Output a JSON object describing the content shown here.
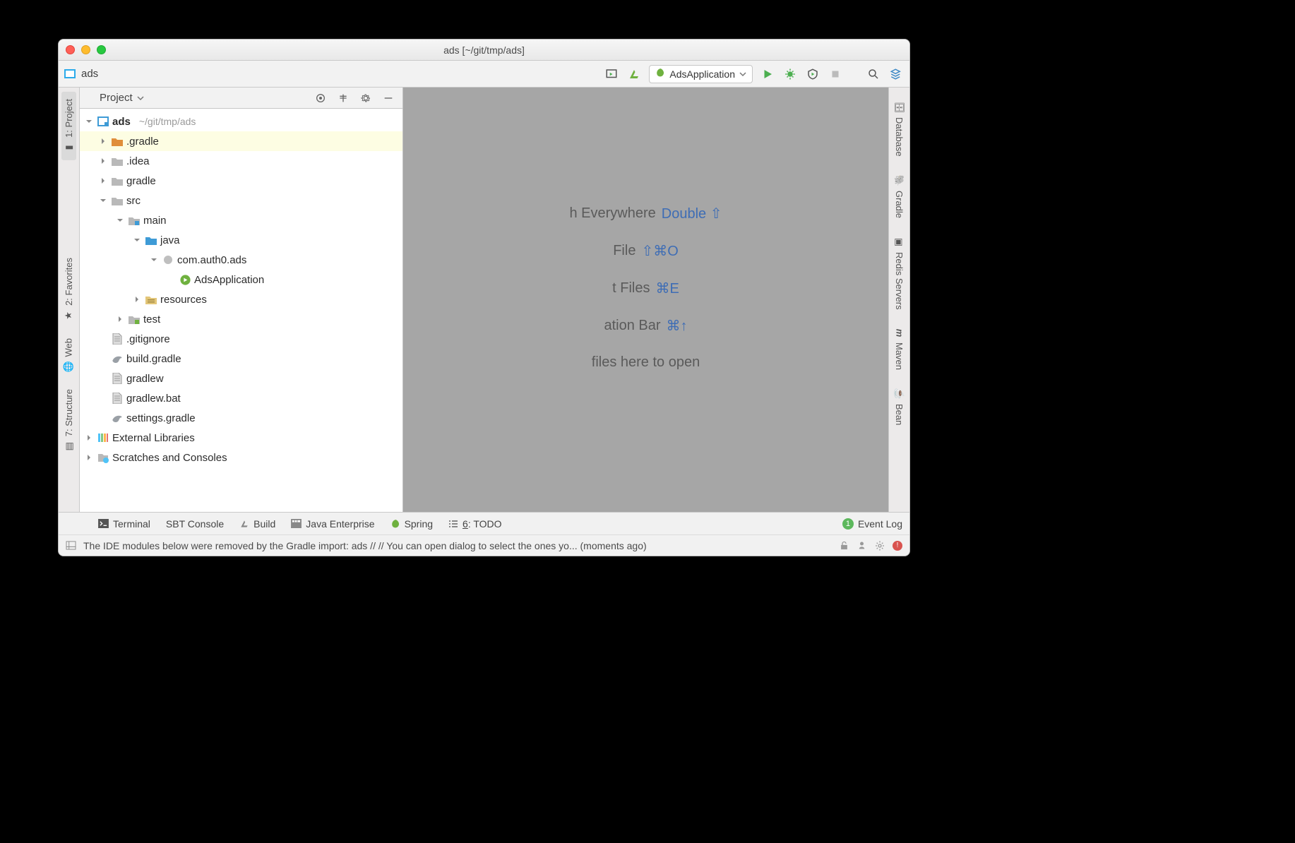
{
  "window": {
    "title": "ads [~/git/tmp/ads]"
  },
  "breadcrumb": {
    "project": "ads"
  },
  "runconfig": {
    "label": "AdsApplication"
  },
  "left_tabs": {
    "project": "1: Project",
    "favorites": "2: Favorites",
    "web": "Web",
    "structure": "7: Structure"
  },
  "right_tabs": {
    "database": "Database",
    "gradle": "Gradle",
    "redis": "Redis Servers",
    "maven": "Maven",
    "bean": "Bean"
  },
  "projtool": {
    "title": "Project"
  },
  "tree": {
    "root": "ads",
    "root_path": "~/git/tmp/ads",
    "n_gradle_dot": ".gradle",
    "n_idea": ".idea",
    "n_gradle": "gradle",
    "n_src": "src",
    "n_main": "main",
    "n_java": "java",
    "n_pkg": "com.auth0.ads",
    "n_app": "AdsApplication",
    "n_resources": "resources",
    "n_test": "test",
    "n_gitignore": ".gitignore",
    "n_buildgradle": "build.gradle",
    "n_gradlew": "gradlew",
    "n_gradlewbat": "gradlew.bat",
    "n_settings": "settings.gradle",
    "n_ext": "External Libraries",
    "n_scratch": "Scratches and Consoles"
  },
  "editor_hints": {
    "h1a": "h Everywhere",
    "h1b": "Double ⇧",
    "h2a": "File",
    "h2b": "⇧⌘O",
    "h3a": "t Files",
    "h3b": "⌘E",
    "h4a": "ation Bar",
    "h4b": "⌘↑",
    "h5": "files here to open"
  },
  "bottom": {
    "terminal": "Terminal",
    "sbt": "SBT Console",
    "build": "Build",
    "jee": "Java Enterprise",
    "spring": "Spring",
    "todo_num": "6",
    "todo_label": ": TODO",
    "eventlog": "Event Log",
    "event_badge": "1"
  },
  "status": {
    "msg": "The IDE modules below were removed by the Gradle import: ads // // You can open dialog to select the ones yo... (moments ago)"
  }
}
